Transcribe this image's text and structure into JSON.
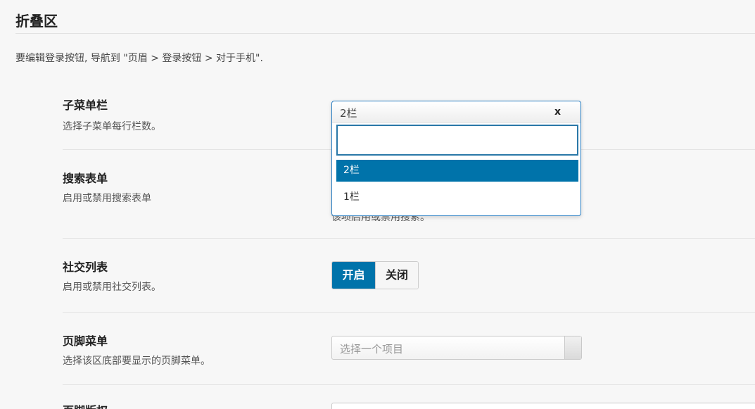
{
  "section": {
    "title": "折叠区",
    "description": "要编辑登录按钮, 导航到 \"页眉 > 登录按钮 > 对于手机\"."
  },
  "options": [
    {
      "label": "子菜单栏",
      "help": "选择子菜单每行栏数。"
    },
    {
      "label": "搜索表单",
      "help": "启用或禁用搜索表单"
    },
    {
      "label": "社交列表",
      "help": "启用或禁用社交列表。"
    },
    {
      "label": "页脚菜单",
      "help": "选择该区底部要显示的页脚菜单。"
    },
    {
      "label": "页脚版权",
      "help": ""
    }
  ],
  "submenu_select": {
    "current": "2栏",
    "clear": "x",
    "search_value": "",
    "items": [
      "2栏",
      "1栏"
    ],
    "active_index": 0
  },
  "search_form_hint": "该项启用或禁用搜索。",
  "social_toggle": {
    "on": "开启",
    "off": "关闭",
    "selected": "开启"
  },
  "footer_menu_select": {
    "placeholder": "选择一个项目"
  },
  "colors": {
    "accent": "#0073aa",
    "focus_border": "#2a7fc3"
  }
}
